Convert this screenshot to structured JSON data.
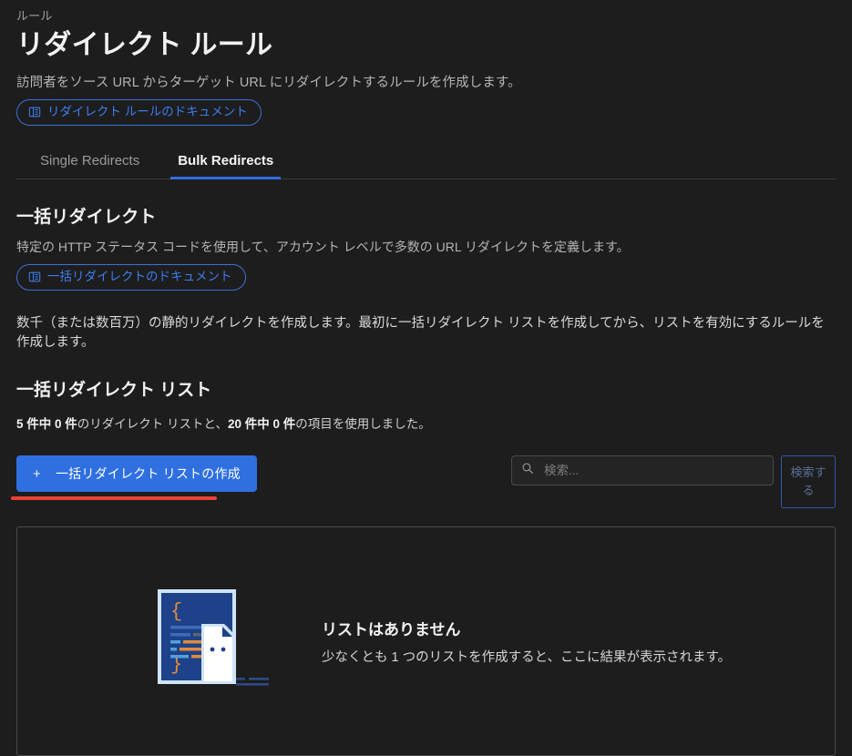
{
  "header": {
    "breadcrumb": "ルール",
    "title": "リダイレクト ルール",
    "description": "訪問者をソース URL からターゲット URL にリダイレクトするルールを作成します。",
    "doc_link_label": "リダイレクト ルールのドキュメント",
    "doc_link_icon": "book-icon"
  },
  "tabs": [
    {
      "label": "Single Redirects",
      "active": false
    },
    {
      "label": "Bulk Redirects",
      "active": true
    }
  ],
  "bulk_section": {
    "title": "一括リダイレクト",
    "description": "特定の HTTP ステータス コードを使用して、アカウント レベルで多数の URL リダイレクトを定義します。",
    "doc_link_label": "一括リダイレクトのドキュメント",
    "doc_link_icon": "book-icon",
    "body_text": "数千（または数百万）の静的リダイレクトを作成します。最初に一括リダイレクト リストを作成してから、リストを有効にするルールを作成します。"
  },
  "list_section": {
    "title": "一括リダイレクト リスト",
    "usage_lists_used": "5 件中 0 件",
    "usage_mid": "のリダイレクト リストと、",
    "usage_items_used": "20 件中 0 件",
    "usage_tail": "の項目を使用しました。"
  },
  "actions": {
    "create_button_label": "一括リダイレクト リストの作成",
    "create_button_icon": "plus-icon",
    "search_placeholder": "検索...",
    "search_value": "",
    "search_icon": "search-icon",
    "search_button_label": "検索する",
    "highlight_color": "#ea4335"
  },
  "empty_state": {
    "title": "リストはありません",
    "subtitle": "少なくとも 1 つのリストを作成すると、ここに結果が表示されます。",
    "illustration": "empty-list-illustration"
  },
  "colors": {
    "background": "#1d1d1d",
    "accent_blue": "#2f6fe0",
    "link_blue": "#3d7cf0",
    "text_primary": "#f2f2f2",
    "text_secondary": "#b4b4b4",
    "highlight_red": "#ea4335"
  }
}
